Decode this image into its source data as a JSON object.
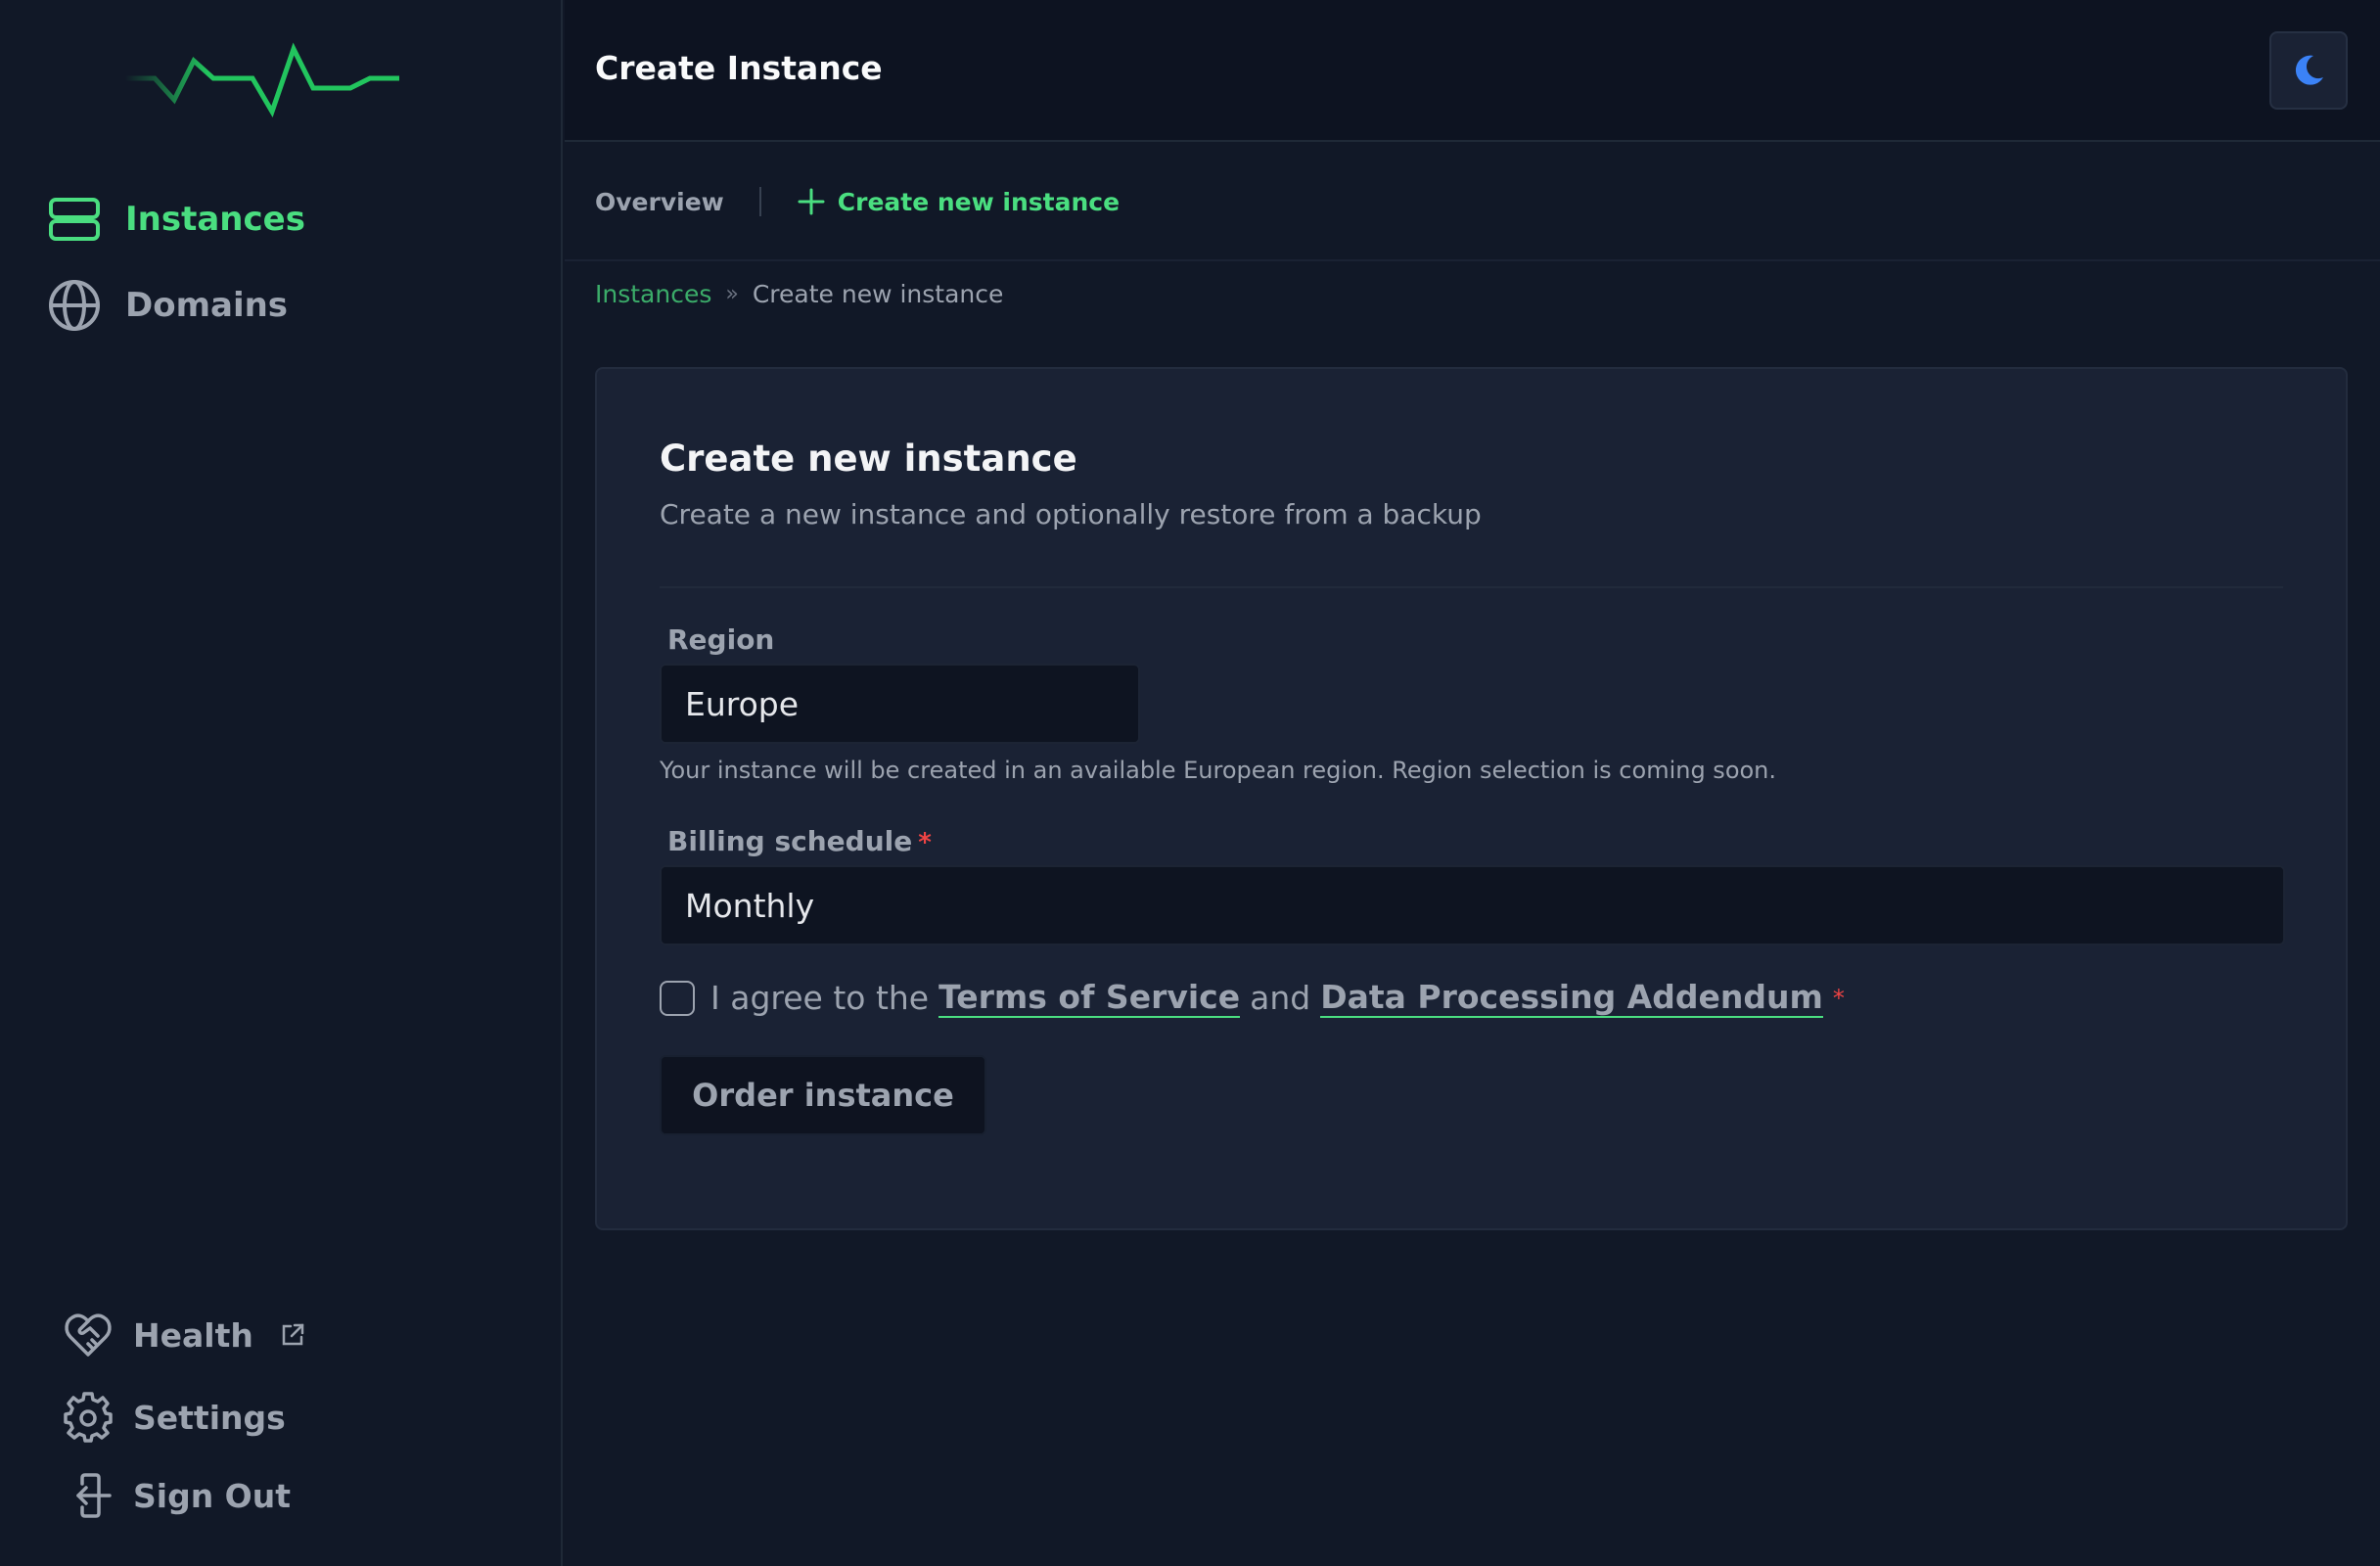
{
  "sidebar": {
    "nav": [
      {
        "label": "Instances",
        "icon": "server-icon",
        "active": true
      },
      {
        "label": "Domains",
        "icon": "globe-icon",
        "active": false
      }
    ],
    "bottom": [
      {
        "label": "Health",
        "icon": "heart-handshake-icon",
        "external": true
      },
      {
        "label": "Settings",
        "icon": "gear-icon"
      },
      {
        "label": "Sign Out",
        "icon": "sign-out-icon"
      }
    ]
  },
  "header": {
    "title": "Create Instance",
    "theme_icon": "moon-icon"
  },
  "subnav": {
    "overview": "Overview",
    "create": "Create new instance"
  },
  "breadcrumb": {
    "root": "Instances",
    "separator": "»",
    "current": "Create new instance"
  },
  "form": {
    "title": "Create new instance",
    "subtitle": "Create a new instance and optionally restore from a backup",
    "region": {
      "label": "Region",
      "value": "Europe",
      "hint": "Your instance will be created in an available European region. Region selection is coming soon."
    },
    "billing": {
      "label": "Billing schedule",
      "required": "*",
      "value": "Monthly"
    },
    "agreement": {
      "prefix": "I agree to the",
      "terms": "Terms of Service",
      "and": "and",
      "dpa": "Data Processing Addendum",
      "required": "*",
      "checked": false
    },
    "submit": "Order instance"
  },
  "colors": {
    "accent": "#4ade80",
    "background": "#111827",
    "card": "#1a2234",
    "required": "#ef4444",
    "moon": "#3b82f6"
  }
}
